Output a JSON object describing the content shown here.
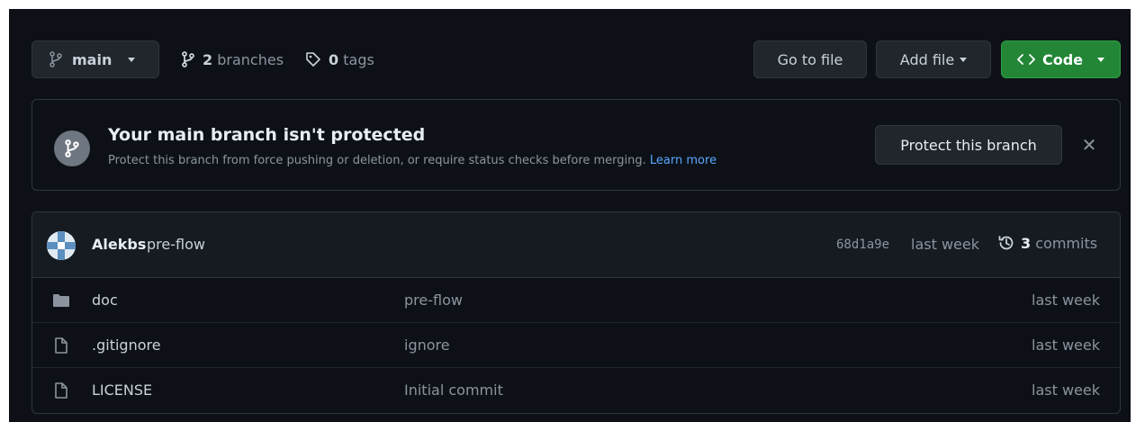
{
  "toolbar": {
    "branch_name": "main",
    "branches_count": "2",
    "branches_label": "branches",
    "tags_count": "0",
    "tags_label": "tags",
    "goto_file": "Go to file",
    "add_file": "Add file",
    "code": "Code"
  },
  "protect": {
    "title": "Your main branch isn't protected",
    "description": "Protect this branch from force pushing or deletion, or require status checks before merging.",
    "learn_more": "Learn more",
    "button": "Protect this branch"
  },
  "commit": {
    "author": "Alekbs",
    "message": "pre-flow",
    "sha": "68d1a9e",
    "time": "last week",
    "commits_count": "3",
    "commits_label": "commits"
  },
  "files": [
    {
      "type": "folder",
      "name": "doc",
      "commit": "pre-flow",
      "time": "last week"
    },
    {
      "type": "file",
      "name": ".gitignore",
      "commit": "ignore",
      "time": "last week"
    },
    {
      "type": "file",
      "name": "LICENSE",
      "commit": "Initial commit",
      "time": "last week"
    }
  ],
  "colors": {
    "background": "#0d1117",
    "code_button": "#238636",
    "link": "#58a6ff"
  }
}
